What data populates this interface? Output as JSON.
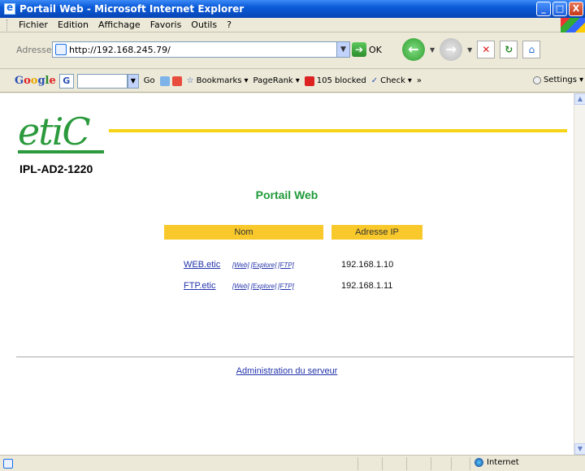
{
  "window": {
    "title": "Portail Web - Microsoft Internet Explorer",
    "buttons": {
      "minimize": "_",
      "maximize": "□",
      "close": "X"
    }
  },
  "menu": [
    "Fichier",
    "Edition",
    "Affichage",
    "Favoris",
    "Outils",
    "?"
  ],
  "address": {
    "label": "Adresse",
    "url": "http://192.168.245.79/",
    "go_label": "OK"
  },
  "google_toolbar": {
    "logo": [
      "G",
      "o",
      "o",
      "g",
      "l",
      "e"
    ],
    "go_label": "Go",
    "bookmarks_label": "Bookmarks",
    "pagerank_label": "PageRank",
    "blocked_label": "105 blocked",
    "check_label": "Check",
    "more_label": "»",
    "settings_label": "Settings"
  },
  "page": {
    "logo_text": "etiC",
    "device_name": "IPL-AD2-1220",
    "title": "Portail Web",
    "table": {
      "headers": {
        "name": "Nom",
        "ip": "Adresse IP"
      },
      "rows": [
        {
          "name": "WEB.etic",
          "links": [
            "[Web]",
            "[Explore]",
            "[FTP]"
          ],
          "ip": "192.168.1.10"
        },
        {
          "name": "FTP.etic",
          "links": [
            "[Web]",
            "[Explore]",
            "[FTP]"
          ],
          "ip": "192.168.1.11"
        }
      ]
    },
    "admin_link": "Administration du serveur"
  },
  "status": {
    "zone": "Internet"
  },
  "colors": {
    "logo_green": "#2b9a3c",
    "title_green": "#1f9a3a",
    "header_yellow": "#f9c92b",
    "line_yellow": "#f7d316",
    "link_blue": "#2233aa"
  }
}
